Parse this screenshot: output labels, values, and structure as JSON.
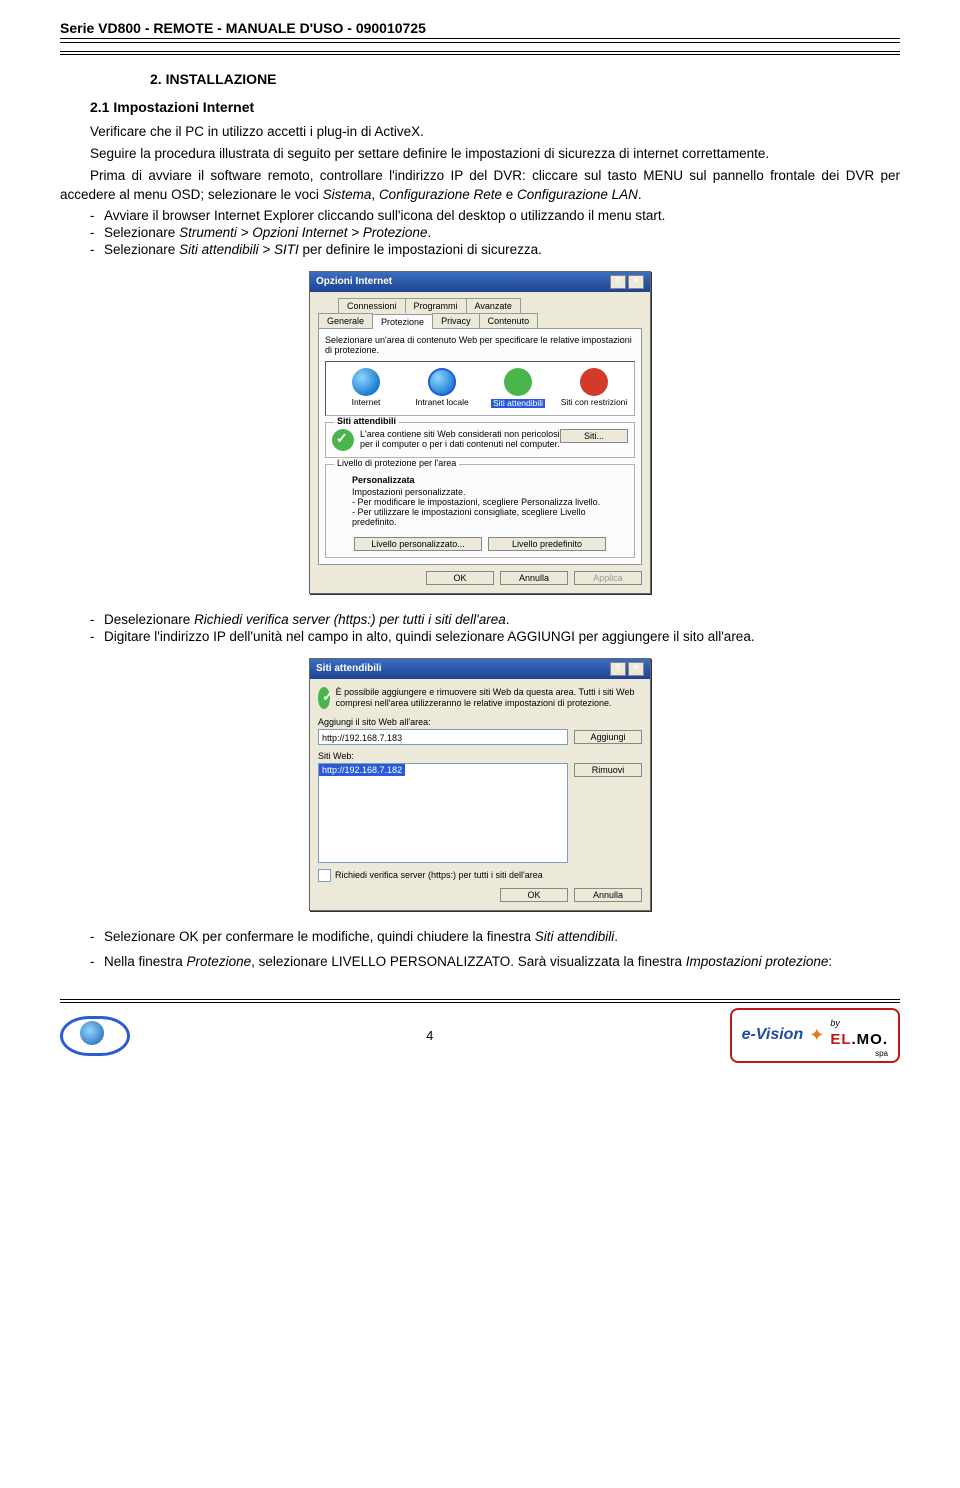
{
  "header": "Serie VD800 - REMOTE   -   MANUALE D'USO   -   090010725",
  "section_num": "2. INSTALLAZIONE",
  "subsection": "2.1 Impostazioni Internet",
  "p1": "Verificare che il PC in utilizzo accetti i plug-in di ActiveX.",
  "p2": "Seguire la procedura illustrata di seguito per settare definire le impostazioni di sicurezza di internet correttamente.",
  "p3a": "Prima di avviare il software remoto, controllare l'indirizzo IP del DVR: cliccare sul tasto MENU sul pannello frontale dei DVR per accedere al menu OSD; selezionare le voci ",
  "p3_i1": "Sistema",
  "p3b": ", ",
  "p3_i2": "Configurazione Rete",
  "p3c": " e ",
  "p3_i3": "Configurazione LAN",
  "p3d": ".",
  "li1": "Avviare il browser Internet Explorer cliccando sull'icona del desktop o utilizzando il menu start.",
  "li2a": "Selezionare ",
  "li2i": "Strumenti > Opzioni Internet > Protezione",
  "li2b": ".",
  "li3a": "Selezionare ",
  "li3i": "Siti attendibili > SITI",
  "li3b": " per definire le impostazioni di sicurezza.",
  "dlg1": {
    "title": "Opzioni Internet",
    "tabs_row1": [
      "Connessioni",
      "Programmi",
      "Avanzate"
    ],
    "tabs_row2": [
      "Generale",
      "Protezione",
      "Privacy",
      "Contenuto"
    ],
    "desc": "Selezionare un'area di contenuto Web per specificare le relative impostazioni di protezione.",
    "zones": [
      "Internet",
      "Intranet locale",
      "Siti attendibili",
      "Siti con restrizioni"
    ],
    "grp1_title": "Siti attendibili",
    "grp1_txt": "L'area contiene siti Web considerati non pericolosi per il computer o per i dati contenuti nel computer.",
    "grp1_btn": "Siti...",
    "grp2_title": "Livello di protezione per l'area",
    "grp2_head": "Personalizzata",
    "grp2_l1": "Impostazioni personalizzate.",
    "grp2_l2": "- Per modificare le impostazioni, scegliere Personalizza livello.",
    "grp2_l3": "- Per utilizzare le impostazioni consigliate, scegliere Livello predefinito.",
    "btn_custom": "Livello personalizzato...",
    "btn_default": "Livello predefinito",
    "btn_ok": "OK",
    "btn_cancel": "Annulla",
    "btn_apply": "Applica"
  },
  "li4a": "Deselezionare ",
  "li4i": "Richiedi verifica server (https:) per tutti i siti dell'area",
  "li4b": ".",
  "li5": "Digitare l'indirizzo IP dell'unità nel campo in alto, quindi selezionare AGGIUNGI per aggiungere il sito all'area.",
  "dlg2": {
    "title": "Siti attendibili",
    "msg": "È possibile aggiungere e rimuovere siti Web da questa area. Tutti i siti Web compresi nell'area utilizzeranno le relative impostazioni di protezione.",
    "lbl_add": "Aggiungi il sito Web all'area:",
    "input_val": "http://192.168.7.183",
    "btn_add": "Aggiungi",
    "lbl_list": "Siti Web:",
    "list_item": "http://192.168.7.182",
    "btn_remove": "Rimuovi",
    "chk": "Richiedi verifica server (https:) per tutti i siti dell'area",
    "btn_ok": "OK",
    "btn_cancel": "Annulla"
  },
  "li6a": "Selezionare OK per confermare le modifiche, quindi chiudere la finestra ",
  "li6i": "Siti attendibili",
  "li6b": ".",
  "li7a": "Nella finestra ",
  "li7i1": "Protezione",
  "li7b": ", selezionare LIVELLO PERSONALIZZATO. Sarà visualizzata la finestra ",
  "li7i2": "Impostazioni protezione",
  "li7c": ":",
  "page_num": "4",
  "brand": {
    "evision": "e-Vision",
    "by": "by",
    "elmo1": "EL",
    "elmo2": ".MO.",
    "spa": "spa"
  }
}
